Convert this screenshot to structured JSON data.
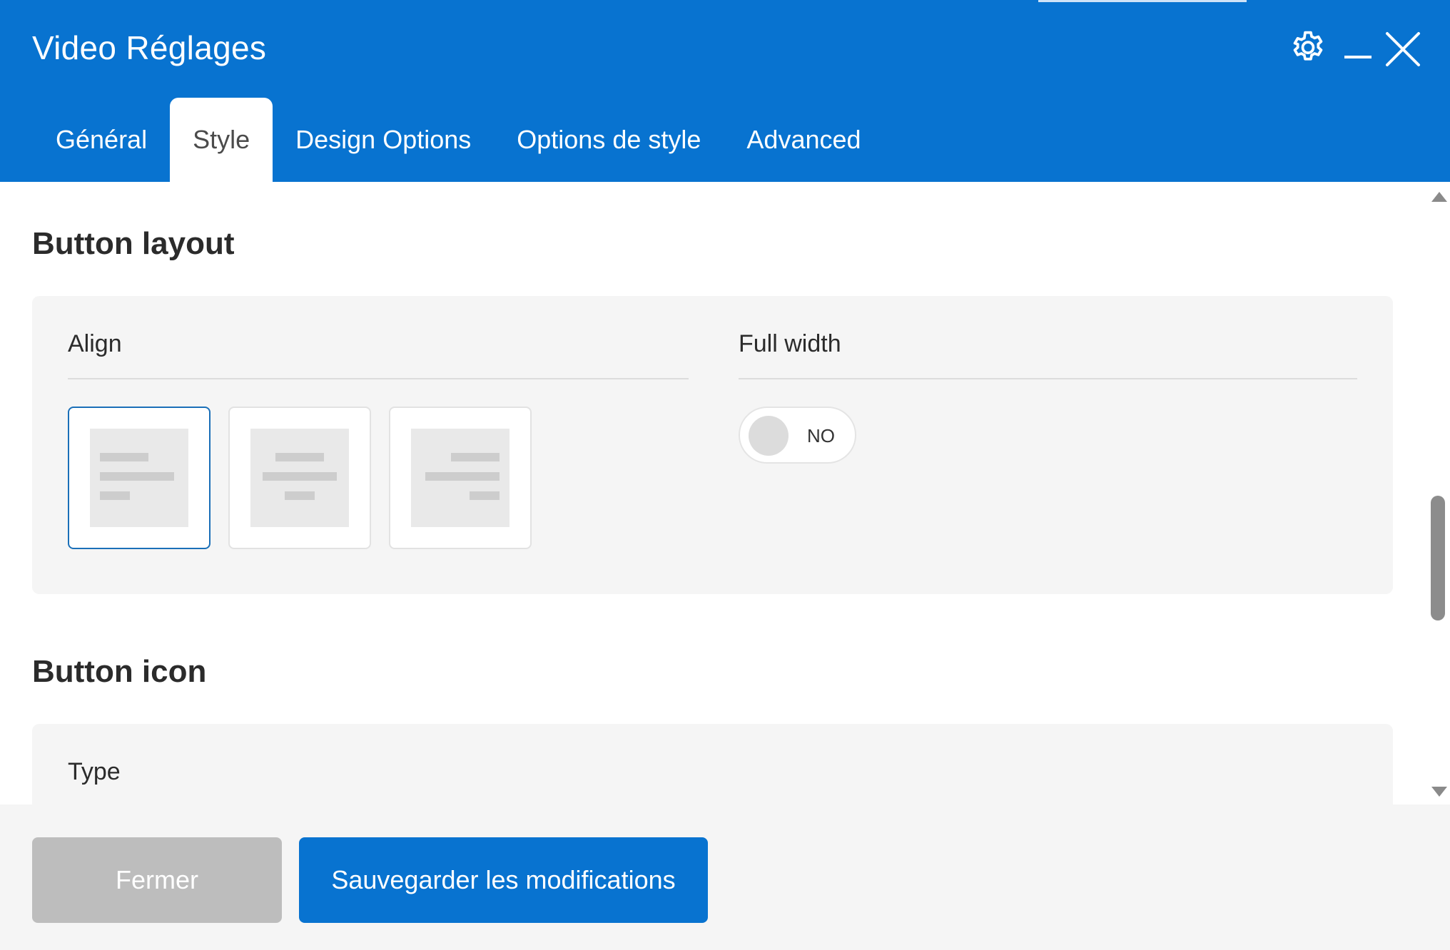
{
  "window": {
    "title": "Video Réglages",
    "icons": [
      "gear-icon",
      "minimize-icon",
      "close-icon"
    ]
  },
  "tabs": [
    {
      "label": "Général",
      "active": false
    },
    {
      "label": "Style",
      "active": true
    },
    {
      "label": "Design Options",
      "active": false
    },
    {
      "label": "Options de style",
      "active": false
    },
    {
      "label": "Advanced",
      "active": false
    }
  ],
  "sections": {
    "button_layout": {
      "title": "Button layout",
      "align": {
        "label": "Align",
        "options": [
          "left",
          "center",
          "right"
        ],
        "selected": "left"
      },
      "full_width": {
        "label": "Full width",
        "value": "NO"
      }
    },
    "button_icon": {
      "title": "Button icon",
      "type_label": "Type"
    }
  },
  "footer": {
    "close_label": "Fermer",
    "save_label": "Sauvegarder les modifications"
  },
  "colors": {
    "primary": "#0873d0",
    "panel_bg": "#f5f5f5",
    "button_disabled": "#bdbdbd",
    "selected_border": "#1a6fb8"
  }
}
